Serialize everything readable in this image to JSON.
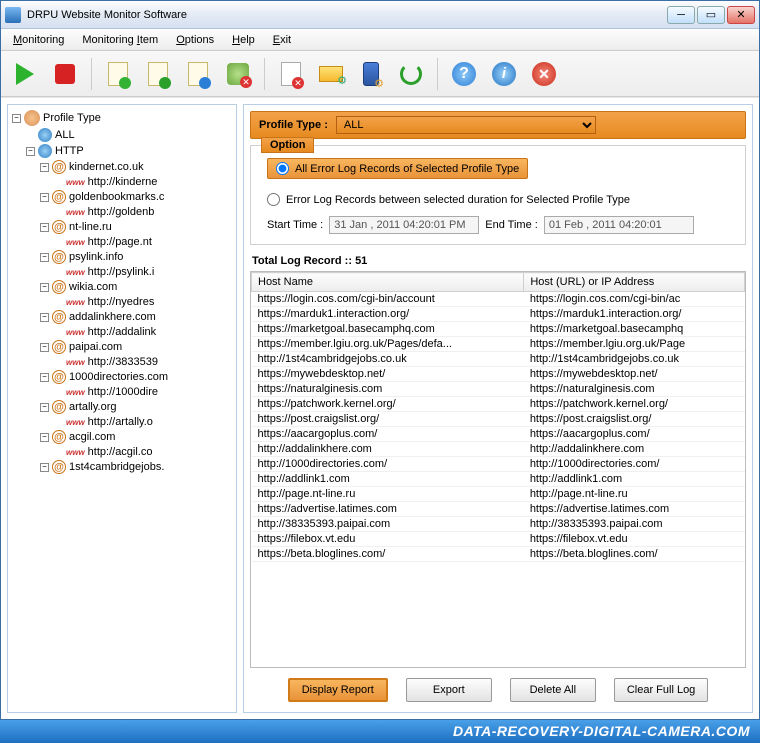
{
  "window": {
    "title": "DRPU Website Monitor Software"
  },
  "menu": {
    "monitoring": "Monitoring",
    "monitoring_item": "Monitoring Item",
    "options": "Options",
    "help": "Help",
    "exit": "Exit"
  },
  "toolbar": {
    "play": "Start",
    "stop": "Stop",
    "add1": "Add",
    "add2": "Add",
    "edit": "Edit",
    "trash": "Delete",
    "page": "Log",
    "mail": "Mail",
    "phone": "SMS",
    "refresh": "Refresh",
    "help": "?",
    "info": "i",
    "exit": "✕"
  },
  "tree": {
    "root": "Profile Type",
    "all": "ALL",
    "http": "HTTP",
    "hosts": [
      {
        "host": "kindernet.co.uk",
        "url": "http://kinderne"
      },
      {
        "host": "goldenbookmarks.c",
        "url": "http://goldenb"
      },
      {
        "host": "nt-line.ru",
        "url": "http://page.nt"
      },
      {
        "host": "psylink.info",
        "url": "http://psylink.i"
      },
      {
        "host": "wikia.com",
        "url": "http://nyedres"
      },
      {
        "host": "addalinkhere.com",
        "url": "http://addalink"
      },
      {
        "host": "paipai.com",
        "url": "http://3833539"
      },
      {
        "host": "1000directories.com",
        "url": "http://1000dire"
      },
      {
        "host": "artally.org",
        "url": "http://artally.o"
      },
      {
        "host": "acgil.com",
        "url": "http://acgil.co"
      },
      {
        "host": "1st4cambridgejobs.",
        "url": ""
      }
    ]
  },
  "profile": {
    "label": "Profile Type :",
    "selected": "ALL"
  },
  "option": {
    "legend": "Option",
    "r1": "All Error Log Records of Selected Profile Type",
    "r2": "Error Log Records between selected duration for Selected Profile Type",
    "start_lbl": "Start Time :",
    "start_val": "31 Jan , 2011 04:20:01 PM",
    "end_lbl": "End Time :",
    "end_val": "01 Feb , 2011 04:20:01"
  },
  "total": "Total Log Record :: 51",
  "cols": {
    "c1": "Host Name",
    "c2": "Host (URL) or IP Address"
  },
  "rows": [
    {
      "h": "https://login.cos.com/cgi-bin/account",
      "u": "https://login.cos.com/cgi-bin/ac"
    },
    {
      "h": "https://marduk1.interaction.org/",
      "u": "https://marduk1.interaction.org/"
    },
    {
      "h": "https://marketgoal.basecamphq.com",
      "u": "https://marketgoal.basecamphq"
    },
    {
      "h": "https://member.lgiu.org.uk/Pages/defa...",
      "u": "https://member.lgiu.org.uk/Page"
    },
    {
      "h": "http://1st4cambridgejobs.co.uk",
      "u": "http://1st4cambridgejobs.co.uk"
    },
    {
      "h": "https://mywebdesktop.net/",
      "u": "https://mywebdesktop.net/"
    },
    {
      "h": "https://naturalginesis.com",
      "u": "https://naturalginesis.com"
    },
    {
      "h": "https://patchwork.kernel.org/",
      "u": "https://patchwork.kernel.org/"
    },
    {
      "h": "https://post.craigslist.org/",
      "u": "https://post.craigslist.org/"
    },
    {
      "h": "https://aacargoplus.com/",
      "u": "https://aacargoplus.com/"
    },
    {
      "h": "http://addalinkhere.com",
      "u": "http://addalinkhere.com"
    },
    {
      "h": "http://1000directories.com/",
      "u": "http://1000directories.com/"
    },
    {
      "h": "http://addlink1.com",
      "u": "http://addlink1.com"
    },
    {
      "h": "http://page.nt-line.ru",
      "u": "http://page.nt-line.ru"
    },
    {
      "h": "https://advertise.latimes.com",
      "u": "https://advertise.latimes.com"
    },
    {
      "h": "http://38335393.paipai.com",
      "u": "http://38335393.paipai.com"
    },
    {
      "h": "https://filebox.vt.edu",
      "u": "https://filebox.vt.edu"
    },
    {
      "h": "https://beta.bloglines.com/",
      "u": "https://beta.bloglines.com/"
    }
  ],
  "buttons": {
    "display": "Display Report",
    "export": "Export",
    "delete": "Delete All",
    "clear": "Clear Full Log"
  },
  "brand": "DATA-RECOVERY-DIGITAL-CAMERA.COM"
}
